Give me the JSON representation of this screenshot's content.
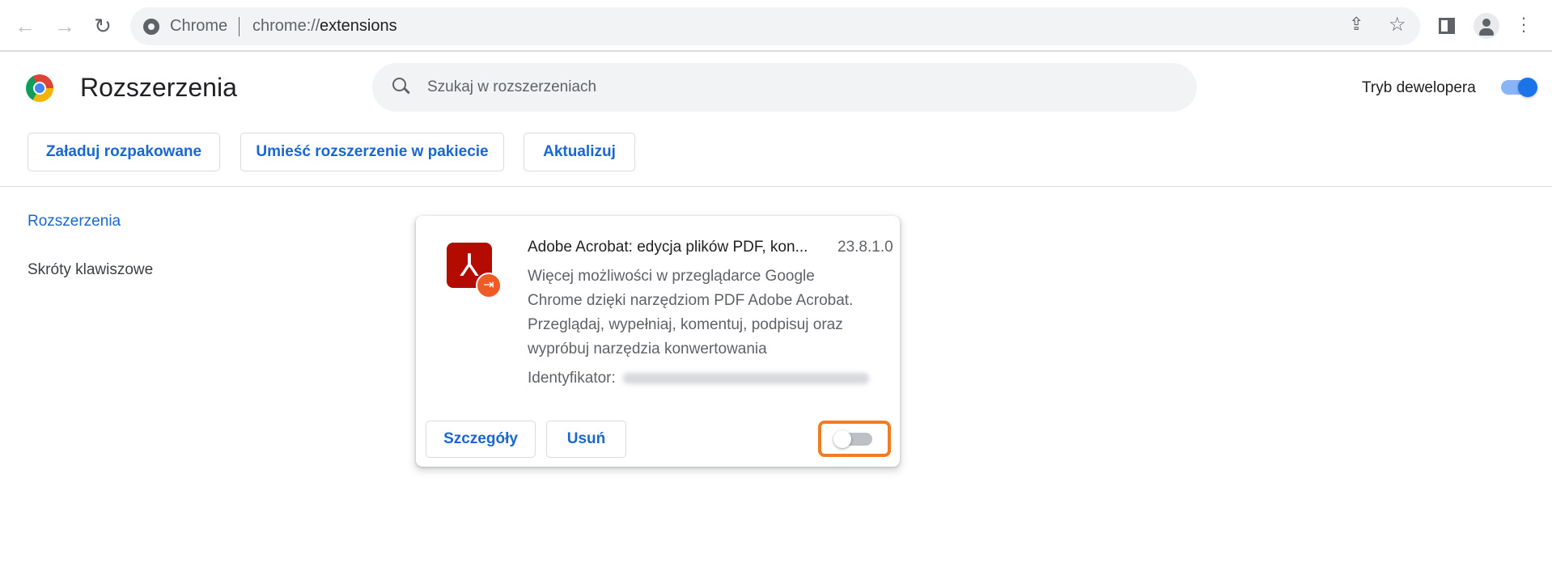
{
  "browser": {
    "omnibox_label": "Chrome",
    "url_prefix": "chrome://",
    "url_host": "extensions"
  },
  "header": {
    "title": "Rozszerzenia",
    "search_placeholder": "Szukaj w rozszerzeniach",
    "dev_mode_label": "Tryb dewelopera",
    "dev_mode_on": true
  },
  "actions": {
    "load_unpacked": "Załaduj rozpakowane",
    "pack": "Umieść rozszerzenie w pakiecie",
    "update": "Aktualizuj"
  },
  "sidebar": {
    "items": [
      {
        "label": "Rozszerzenia",
        "active": true
      },
      {
        "label": "Skróty klawiszowe",
        "active": false
      }
    ]
  },
  "extension": {
    "name": "Adobe Acrobat: edycja plików PDF, kon...",
    "version": "23.8.1.0",
    "description_lines": [
      "Więcej możliwości w przeglądarce Google",
      "Chrome dzięki narzędziom PDF Adobe Acrobat.",
      "Przeglądaj, wypełniaj, komentuj, podpisuj oraz",
      "wypróbuj narzędzia konwertowania"
    ],
    "id_label": "Identyfikator:",
    "details_label": "Szczegóły",
    "remove_label": "Usuń",
    "enabled": false
  },
  "colors": {
    "accent": "#1a73e8",
    "highlight": "#f47b20",
    "acrobat_red": "#b30b00"
  }
}
